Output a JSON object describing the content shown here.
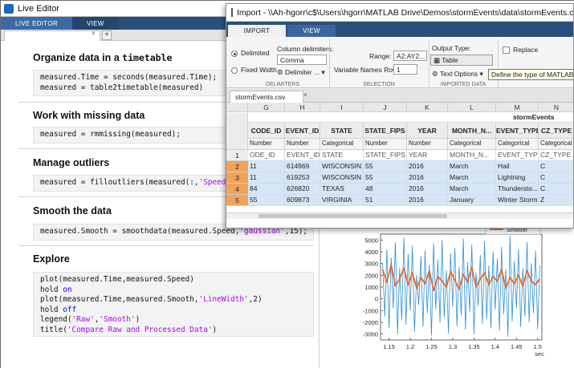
{
  "live_editor": {
    "title": "Live Editor",
    "toolstrip_tabs": [
      "LIVE EDITOR",
      "VIEW"
    ],
    "doc_close": "×",
    "doc_add": "+",
    "sections": [
      {
        "heading": "Organize data in a ",
        "heading_mono": "timetable",
        "code": [
          [
            "measured.Time = seconds(measured.Time);"
          ],
          [
            "measured = table2timetable(measured)"
          ]
        ]
      },
      {
        "heading": "Work with missing data",
        "heading_mono": "",
        "code": [
          [
            "measured = rmmissing(measured);"
          ]
        ]
      },
      {
        "heading": "Manage outliers",
        "heading_mono": "",
        "code": [
          [
            "measured = filloutliers(measured(:,",
            "'Speed'",
            "),"
          ]
        ]
      },
      {
        "heading": "Smooth the data",
        "heading_mono": "",
        "code": [
          [
            "measured.Smooth = smoothdata(measured.Speed,",
            "'gaussian'",
            ",15);"
          ]
        ]
      },
      {
        "heading": "Explore",
        "heading_mono": ""
      }
    ],
    "explore_code": {
      "l1": "plot(measured.Time,measured.Speed)",
      "l2a": "hold ",
      "l2b": "on",
      "l3a": "plot(measured.Time,measured.Smooth,",
      "l3b": "'LineWidth'",
      "l3c": ",2)",
      "l4a": "hold ",
      "l4b": "off",
      "l5a": "legend(",
      "l5b": "'Raw'",
      "l5c": ",",
      "l5d": "'Smooth'",
      "l5e": ")",
      "l6a": "title(",
      "l6b": "'Compare Raw and Processed Data'",
      "l6c": ")"
    }
  },
  "import_window": {
    "title": "Import - \\\\Ah-hgorr\\c$\\Users\\hgorr\\MATLAB Drive\\Demos\\stormEvents\\data\\stormEvents.csv",
    "tabs": [
      "IMPORT",
      "VIEW"
    ],
    "delimited_label": "Delimited",
    "fixed_width_label": "Fixed Width",
    "column_delimiters_label": "Column delimiters:",
    "delimiter_value": "Comma",
    "delimiter_options_label": "Delimiter ...",
    "range_label": "Range:",
    "range_value": "A2:AY2...",
    "var_names_row_label": "Variable Names Row:",
    "var_names_row_value": "1",
    "output_type_label": "Output Type:",
    "output_type_value": "Table",
    "text_options_label": "Text Options",
    "replace_label": "Replace",
    "group_labels": [
      "DELIMITERS",
      "SELECTION",
      "IMPORTED DATA"
    ],
    "tooltip": "Define the type of MATLAB",
    "file_tab": "stormEvents.csv",
    "file_tab_close": "×",
    "group_header": "stormEvents",
    "col_letters": [
      "G",
      "H",
      "I",
      "J",
      "K",
      "L",
      "M",
      "N"
    ],
    "var_names": [
      "CODE_ID",
      "EVENT_ID",
      "STATE",
      "STATE_FIPS",
      "YEAR",
      "MONTH_N...",
      "EVENT_TYPE",
      "CZ_TYPE"
    ],
    "types": [
      "Number",
      "Number",
      "Categorical",
      "Number",
      "Number",
      "Categorical",
      "Categorical",
      "Categorical"
    ],
    "header_row_num": "1",
    "header_row": [
      "ODE_ID",
      "EVENT_ID",
      "STATE",
      "STATE_FIPS",
      "YEAR",
      "MONTH_N...",
      "EVENT_TYPE",
      "CZ_TYPE"
    ],
    "rows": [
      {
        "num": "2",
        "cells": [
          "11",
          "614969",
          "WISCONSIN",
          "55",
          "2016",
          "March",
          "Hail",
          "C"
        ]
      },
      {
        "num": "3",
        "cells": [
          "11",
          "619253",
          "WISCONSIN",
          "55",
          "2016",
          "March",
          "Lightning",
          "C"
        ]
      },
      {
        "num": "4",
        "cells": [
          "84",
          "626820",
          "TEXAS",
          "48",
          "2016",
          "March",
          "Thundersto...",
          "C"
        ]
      },
      {
        "num": "5",
        "cells": [
          "55",
          "609873",
          "VIRGINIA",
          "51",
          "2016",
          "January",
          "Winter Storm",
          "Z"
        ]
      }
    ]
  },
  "figure": {
    "legend_smooth": "Smooth",
    "xlabel": "sec",
    "colors": {
      "raw": "#2d8fd5",
      "smooth": "#e26a2c"
    },
    "chart_data": {
      "type": "line",
      "xlim": [
        1.13,
        1.51
      ],
      "ylim": [
        -3500,
        5500
      ],
      "y_ticks": [
        5000,
        4000,
        3000,
        2000,
        1000,
        0,
        -1000,
        -2000,
        -3000
      ],
      "x_ticks": [
        1.15,
        1.2,
        1.25,
        1.3,
        1.35,
        1.4,
        1.45,
        1.5
      ],
      "x_tick_labels": [
        "1.15",
        "1.2",
        "1.25",
        "1.3",
        "1.35",
        "1.4",
        "1.45",
        "1.5"
      ],
      "series": [
        {
          "name": "Raw",
          "x": [
            1.135,
            1.14,
            1.145,
            1.15,
            1.155,
            1.16,
            1.165,
            1.17,
            1.175,
            1.18,
            1.185,
            1.19,
            1.195,
            1.2,
            1.205,
            1.21,
            1.215,
            1.22,
            1.225,
            1.23,
            1.235,
            1.24,
            1.245,
            1.25,
            1.255,
            1.26,
            1.265,
            1.27,
            1.275,
            1.28,
            1.285,
            1.29,
            1.295,
            1.3,
            1.305,
            1.31,
            1.315,
            1.32,
            1.325,
            1.33,
            1.335,
            1.34,
            1.345,
            1.35,
            1.355,
            1.36,
            1.365,
            1.37,
            1.375,
            1.38,
            1.385,
            1.39,
            1.395,
            1.4,
            1.405,
            1.41,
            1.415,
            1.42,
            1.425,
            1.43,
            1.435,
            1.44,
            1.445,
            1.45,
            1.455,
            1.46,
            1.465,
            1.47,
            1.475,
            1.48,
            1.485,
            1.49,
            1.495,
            1.5,
            1.505
          ],
          "values": [
            3000,
            -1500,
            4200,
            -2500,
            3500,
            -800,
            4800,
            -3000,
            2600,
            -1800,
            5200,
            -2200,
            3800,
            -1000,
            4500,
            -2800,
            2000,
            -500,
            3600,
            -2400,
            4100,
            -1200,
            2900,
            -3100,
            4700,
            -900,
            3300,
            -2000,
            5000,
            -1600,
            2400,
            -2900,
            3900,
            -700,
            4300,
            -2300,
            2700,
            -1400,
            5100,
            -2600,
            3100,
            -1100,
            4600,
            -3000,
            2200,
            -600,
            3700,
            -2100,
            4900,
            -1700,
            2800,
            -2500,
            4000,
            -900,
            3400,
            -2700,
            4400,
            -1300,
            2500,
            -3200,
            5300,
            -1900,
            3200,
            -800,
            4200,
            -2400,
            2600,
            -1500,
            4800,
            -2000,
            3000,
            -1200,
            4100,
            -2600,
            2800
          ]
        },
        {
          "name": "Smooth",
          "x": [
            1.135,
            1.145,
            1.155,
            1.165,
            1.175,
            1.185,
            1.195,
            1.205,
            1.215,
            1.225,
            1.235,
            1.245,
            1.255,
            1.265,
            1.275,
            1.285,
            1.295,
            1.305,
            1.315,
            1.325,
            1.335,
            1.345,
            1.355,
            1.365,
            1.375,
            1.385,
            1.395,
            1.405,
            1.415,
            1.425,
            1.435,
            1.445,
            1.455,
            1.465,
            1.475,
            1.485,
            1.495,
            1.505
          ],
          "values": [
            2500,
            1400,
            2900,
            1100,
            1700,
            2600,
            1200,
            2200,
            900,
            1800,
            1300,
            2400,
            700,
            1900,
            1500,
            1000,
            2300,
            1600,
            800,
            2100,
            1400,
            2700,
            1000,
            1700,
            2200,
            1200,
            1900,
            1500,
            2500,
            900,
            1800,
            1300,
            2000,
            1100,
            2400,
            1500,
            1200,
            1700
          ]
        }
      ]
    }
  }
}
